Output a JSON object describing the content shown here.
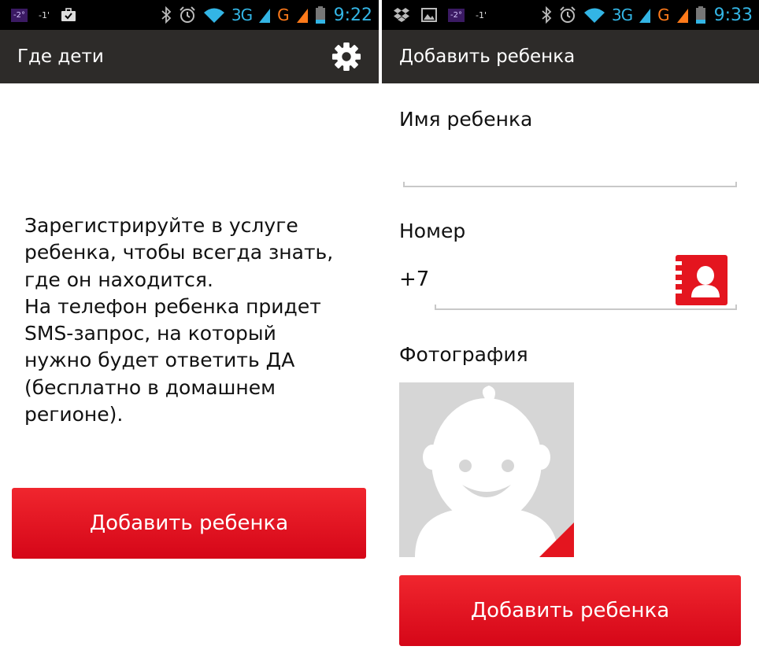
{
  "left": {
    "status": {
      "temperature": "-2°",
      "signal_small": "-1'",
      "network": "3G",
      "network2": "G",
      "time": "9:22"
    },
    "title": "Где дети",
    "info_text": "Зарегистрируйте в услуге\nребенка, чтобы всегда знать,\nгде он находится.\nНа телефон ребенка придет\nSMS-запрос, на который\nнужно будет ответить ДА\n(бесплатно в домашнем\nрегионе).",
    "add_button": "Добавить ребенка"
  },
  "right": {
    "status": {
      "temperature": "-2°",
      "signal_small": "-1'",
      "network": "3G",
      "network2": "G",
      "time": "9:33"
    },
    "title": "Добавить ребенка",
    "name_label": "Имя ребенка",
    "name_value": "",
    "number_label": "Номер",
    "number_prefix": "+7",
    "number_value": "",
    "photo_label": "Фотография",
    "add_button": "Добавить ребенка"
  },
  "colors": {
    "accent": "#e4151f",
    "actionbar": "#2d2b29",
    "statusbar": "#000000",
    "status_blue": "#33b5e5",
    "status_orange": "#ff7a1a"
  },
  "icons": [
    "tag-icon",
    "briefcase-icon",
    "dropbox-icon",
    "image-icon",
    "bluetooth-icon",
    "alarm-icon",
    "wifi-icon",
    "signal-icon",
    "battery-icon",
    "gear-icon",
    "contacts-book-icon",
    "avatar-placeholder-icon"
  ]
}
